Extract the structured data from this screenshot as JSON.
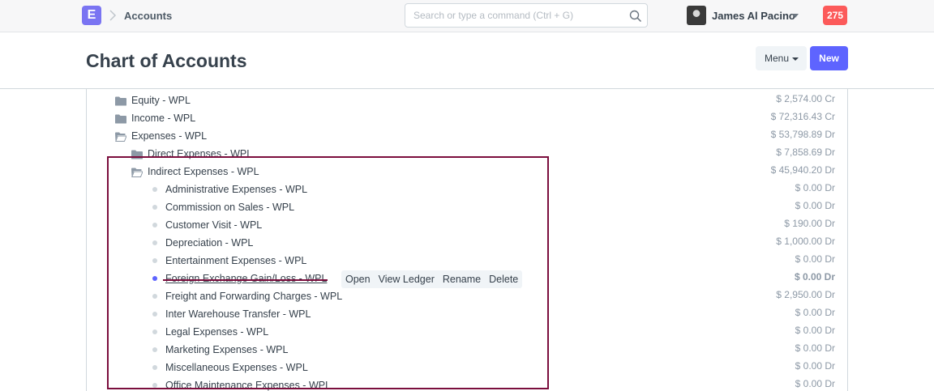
{
  "navbar": {
    "logo_letter": "E",
    "breadcrumb": "Accounts",
    "search_placeholder": "Search or type a command (Ctrl + G)",
    "user_name": "James Al Pacino",
    "notification_count": "275"
  },
  "page": {
    "title": "Chart of Accounts",
    "menu_label": "Menu",
    "new_label": "New"
  },
  "tree": [
    {
      "label": "Equity - WPL",
      "balance": "$ 2,574.00 Cr",
      "type": "folder"
    },
    {
      "label": "Income - WPL",
      "balance": "$ 72,316.43 Cr",
      "type": "folder"
    },
    {
      "label": "Expenses - WPL",
      "balance": "$ 53,798.89 Dr",
      "type": "folder-open"
    },
    {
      "label": "Direct Expenses - WPL",
      "balance": "$ 7,858.69 Dr",
      "type": "folder"
    },
    {
      "label": "Indirect Expenses - WPL",
      "balance": "$ 45,940.20 Dr",
      "type": "folder-open"
    },
    {
      "label": "Administrative Expenses - WPL",
      "balance": "$ 0.00 Dr",
      "type": "leaf"
    },
    {
      "label": "Commission on Sales - WPL",
      "balance": "$ 0.00 Dr",
      "type": "leaf"
    },
    {
      "label": "Customer Visit - WPL",
      "balance": "$ 190.00 Dr",
      "type": "leaf"
    },
    {
      "label": "Depreciation - WPL",
      "balance": "$ 1,000.00 Dr",
      "type": "leaf"
    },
    {
      "label": "Entertainment Expenses - WPL",
      "balance": "$ 0.00 Dr",
      "type": "leaf"
    },
    {
      "label": "Foreign Exchange Gain/Loss - WPL",
      "balance": "$ 0.00 Dr",
      "type": "leaf-selected"
    },
    {
      "label": "Freight and Forwarding Charges - WPL",
      "balance": "$ 2,950.00 Dr",
      "type": "leaf"
    },
    {
      "label": "Inter Warehouse Transfer - WPL",
      "balance": "$ 0.00 Dr",
      "type": "leaf"
    },
    {
      "label": "Legal Expenses - WPL",
      "balance": "$ 0.00 Dr",
      "type": "leaf"
    },
    {
      "label": "Marketing Expenses - WPL",
      "balance": "$ 0.00 Dr",
      "type": "leaf"
    },
    {
      "label": "Miscellaneous Expenses - WPL",
      "balance": "$ 0.00 Dr",
      "type": "leaf"
    },
    {
      "label": "Office Maintenance Expenses - WPL",
      "balance": "$ 0.00 Dr",
      "type": "leaf"
    }
  ],
  "row_actions": {
    "open": "Open",
    "view_ledger": "View Ledger",
    "rename": "Rename",
    "delete": "Delete"
  },
  "colors": {
    "accent": "#5e64ff",
    "highlight": "#7b0e3d",
    "notification": "#fc5a5a"
  }
}
